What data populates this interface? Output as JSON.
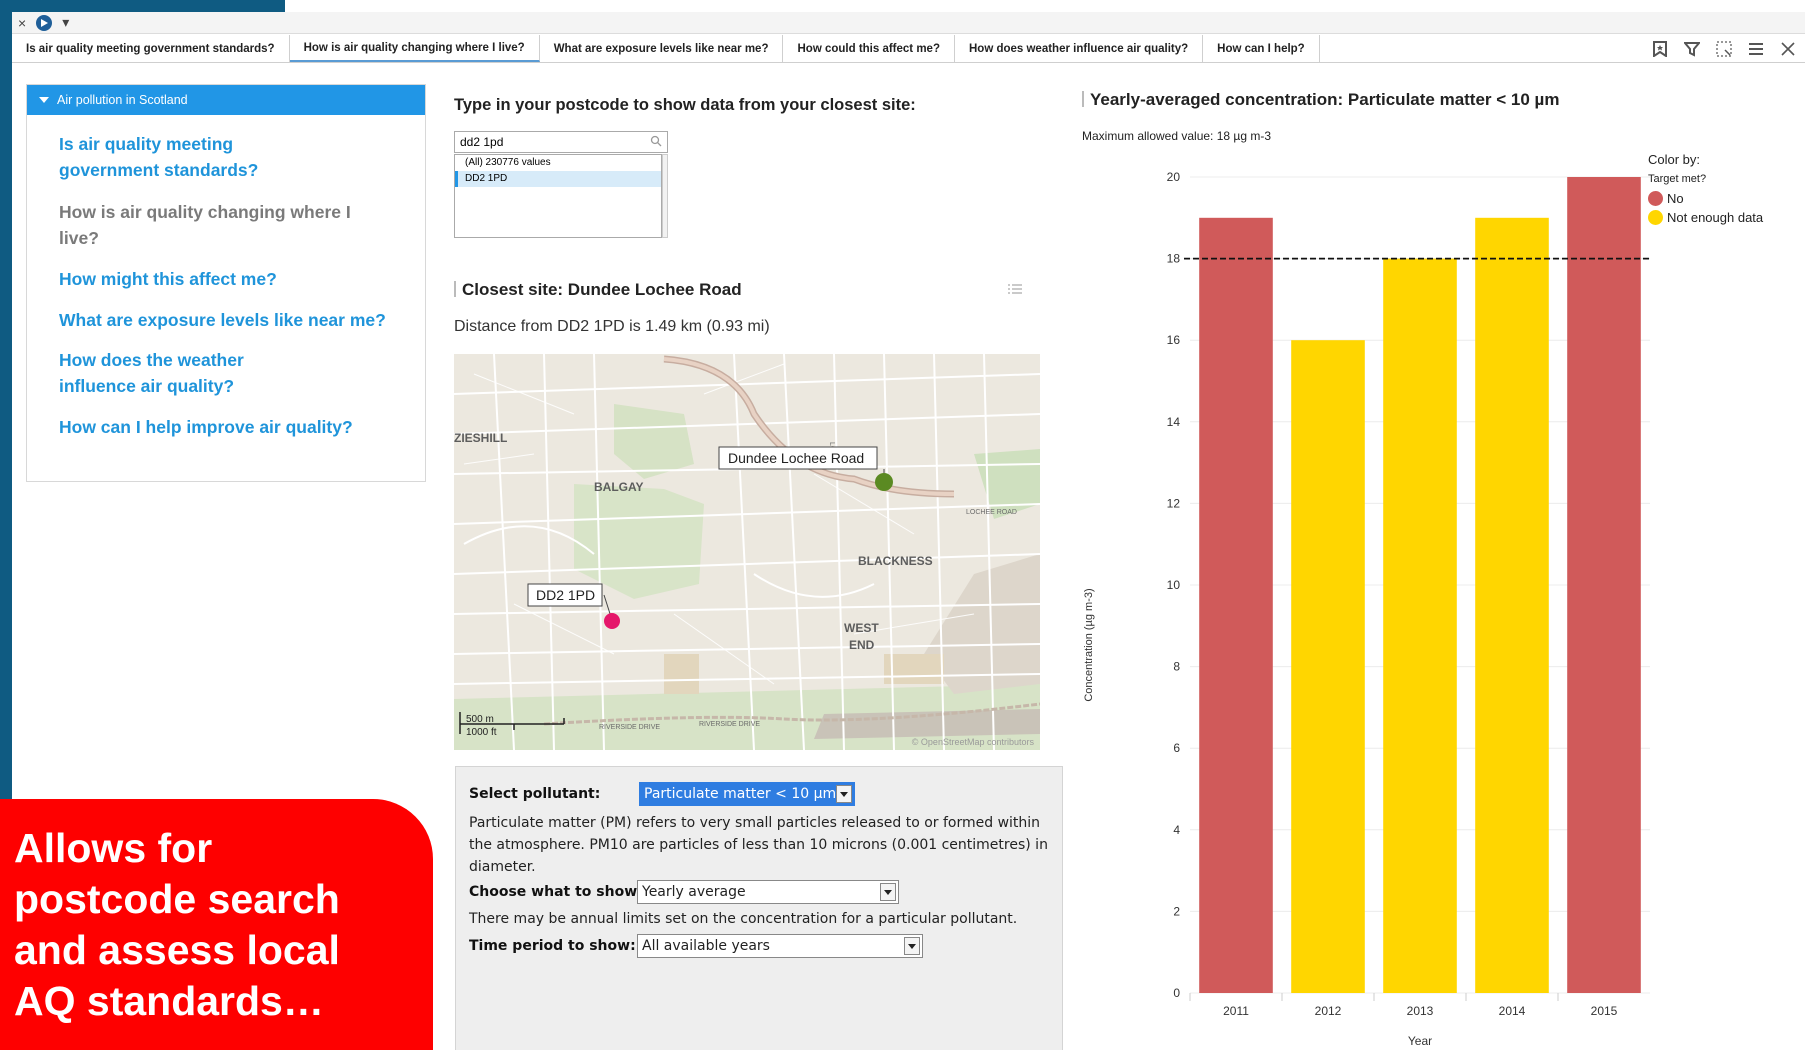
{
  "toolbar": {
    "close_symbol": "×",
    "nav_icon": "navigate-icon",
    "menu_arrow": "▾"
  },
  "tabs": [
    {
      "label": "Is air quality meeting government standards?"
    },
    {
      "label": "How is air quality changing where I live?"
    },
    {
      "label": "What are exposure levels like near me?"
    },
    {
      "label": "How could this affect me?"
    },
    {
      "label": "How does weather influence air quality?"
    },
    {
      "label": "How can I help?"
    }
  ],
  "tab_icons": [
    "bookmark-icon",
    "filter-icon",
    "fullscreen-icon",
    "menu-icon",
    "close-icon"
  ],
  "sidebar": {
    "header": "Air pollution in Scotland",
    "items": [
      {
        "label": "Is air quality meeting government standards?"
      },
      {
        "label": "How is air quality changing where I live?"
      },
      {
        "label": "How might this affect me?"
      },
      {
        "label": "What are exposure levels like near me?"
      },
      {
        "label": "How does the weather influence air quality?"
      },
      {
        "label": "How can I help improve air quality?"
      }
    ]
  },
  "postcode": {
    "title": "Type in your postcode to show data from your closest site:",
    "value": "dd2 1pd",
    "options": [
      "(All) 230776 values",
      "DD2 1PD"
    ],
    "selected": "DD2 1PD"
  },
  "site": {
    "title": "Closest site: Dundee Lochee Road",
    "distance": "Distance from DD2 1PD is 1.49 km (0.93 mi)"
  },
  "map": {
    "station_label": "Dundee Lochee Road",
    "postcode_label": "DD2 1PD",
    "places": [
      "ZIESHILL",
      "BALGAY",
      "BLACKNESS",
      "WEST",
      "END",
      "LOCHEE ROAD",
      "RIVERSIDE DRIVE",
      "RIVERSIDE DRIVE",
      "LOCH"
    ],
    "scale_m": "500 m",
    "scale_ft": "1000 ft",
    "attribution": "© OpenStreetMap contributors",
    "station_color": "#5b8a22",
    "postcode_color": "#e5176b"
  },
  "controls": {
    "pollutant_label": "Select pollutant:",
    "pollutant_value": "Particulate matter < 10 µm",
    "description": "Particulate matter (PM) refers to very small particles released to or formed within the atmosphere. PM10 are particles of less than 10 microns (0.001 centimetres) in diameter.",
    "show_label": "Choose what to show:",
    "show_value": "Yearly average",
    "limit_note": "There may be annual limits set on the concentration for a particular pollutant.",
    "period_label": "Time period to show:",
    "period_value": "All available years"
  },
  "chart_data": {
    "type": "bar",
    "title": "Yearly-averaged concentration: Particulate matter < 10 µm",
    "subtitle": "Maximum allowed value: 18 µg m-3",
    "xlabel": "Year",
    "ylabel": "Concentration (µg m-3)",
    "categories": [
      "2011",
      "2012",
      "2013",
      "2014",
      "2015"
    ],
    "values": [
      19,
      16,
      18,
      19,
      20
    ],
    "status": [
      "No",
      "Not enough data",
      "Not enough data",
      "Not enough data",
      "No"
    ],
    "ylim": [
      0,
      20
    ],
    "yticks": [
      0,
      2,
      4,
      6,
      8,
      10,
      12,
      14,
      16,
      18,
      20
    ],
    "threshold": 18,
    "legend": {
      "title": "Color by:",
      "subtitle": "Target met?",
      "items": [
        {
          "name": "No",
          "color": "#d05a5a"
        },
        {
          "name": "Not enough data",
          "color": "#ffd600"
        }
      ],
      "placement": "top-right"
    },
    "grid": true
  },
  "banner": {
    "lines": [
      "Allows for",
      "postcode search",
      "and assess local",
      "AQ standards…"
    ]
  }
}
